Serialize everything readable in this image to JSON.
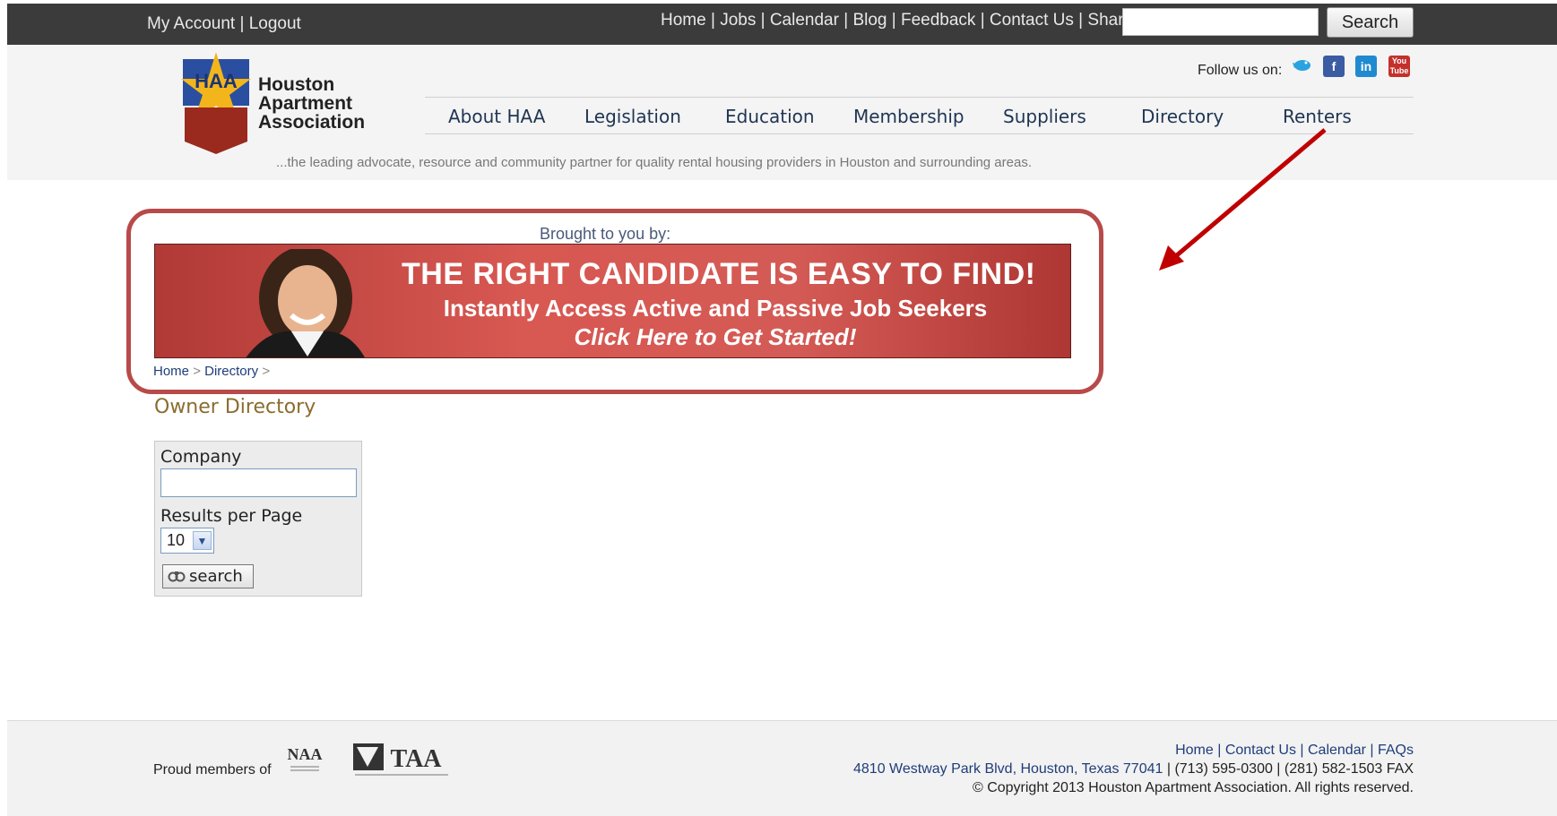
{
  "topbar": {
    "account_links": [
      "My Account",
      "Logout"
    ],
    "nav_links": [
      "Home",
      "Jobs",
      "Calendar",
      "Blog",
      "Feedback",
      "Contact Us",
      "Share"
    ],
    "search_value": "",
    "search_button": "Search"
  },
  "header": {
    "logo_lines": [
      "Houston",
      "Apartment",
      "Association"
    ],
    "logo_mark": "HAA",
    "follow_label": "Follow us on:",
    "social_icons": [
      "twitter-icon",
      "facebook-icon",
      "linkedin-icon",
      "youtube-icon"
    ],
    "nav": [
      "About HAA",
      "Legislation",
      "Education",
      "Membership",
      "Suppliers",
      "Directory",
      "Renters"
    ],
    "tagline": "...the leading advocate, resource and community partner for quality rental housing providers in Houston and surrounding areas."
  },
  "banner": {
    "brought_by": "Brought to you by:",
    "line1": "THE RIGHT CANDIDATE IS EASY TO FIND!",
    "line2": "Instantly Access Active and Passive Job Seekers",
    "line3": "Click Here to Get Started!"
  },
  "breadcrumb": {
    "items": [
      "Home",
      "Directory"
    ],
    "separator": ">"
  },
  "content": {
    "title": "Owner Directory",
    "company_label": "Company",
    "company_value": "",
    "results_label": "Results per Page",
    "results_value": "10",
    "search_button": "search"
  },
  "footer": {
    "proud": "Proud members of",
    "links": [
      "Home",
      "Contact Us",
      "Calendar",
      "FAQs"
    ],
    "address": "4810 Westway Park Blvd, Houston, Texas 77041",
    "phones": "| (713) 595-0300 | (281) 582-1503 FAX",
    "copyright": "© Copyright 2013 Houston Apartment Association. All rights reserved.",
    "logo_naa": "NAA",
    "logo_taa": "TAA"
  },
  "colors": {
    "topbar": "#3b3b3b",
    "annotation_red": "#b84a4a",
    "arrow_red": "#c00000",
    "link_blue": "#1f3d7a",
    "title_gold": "#8a6d2f"
  }
}
